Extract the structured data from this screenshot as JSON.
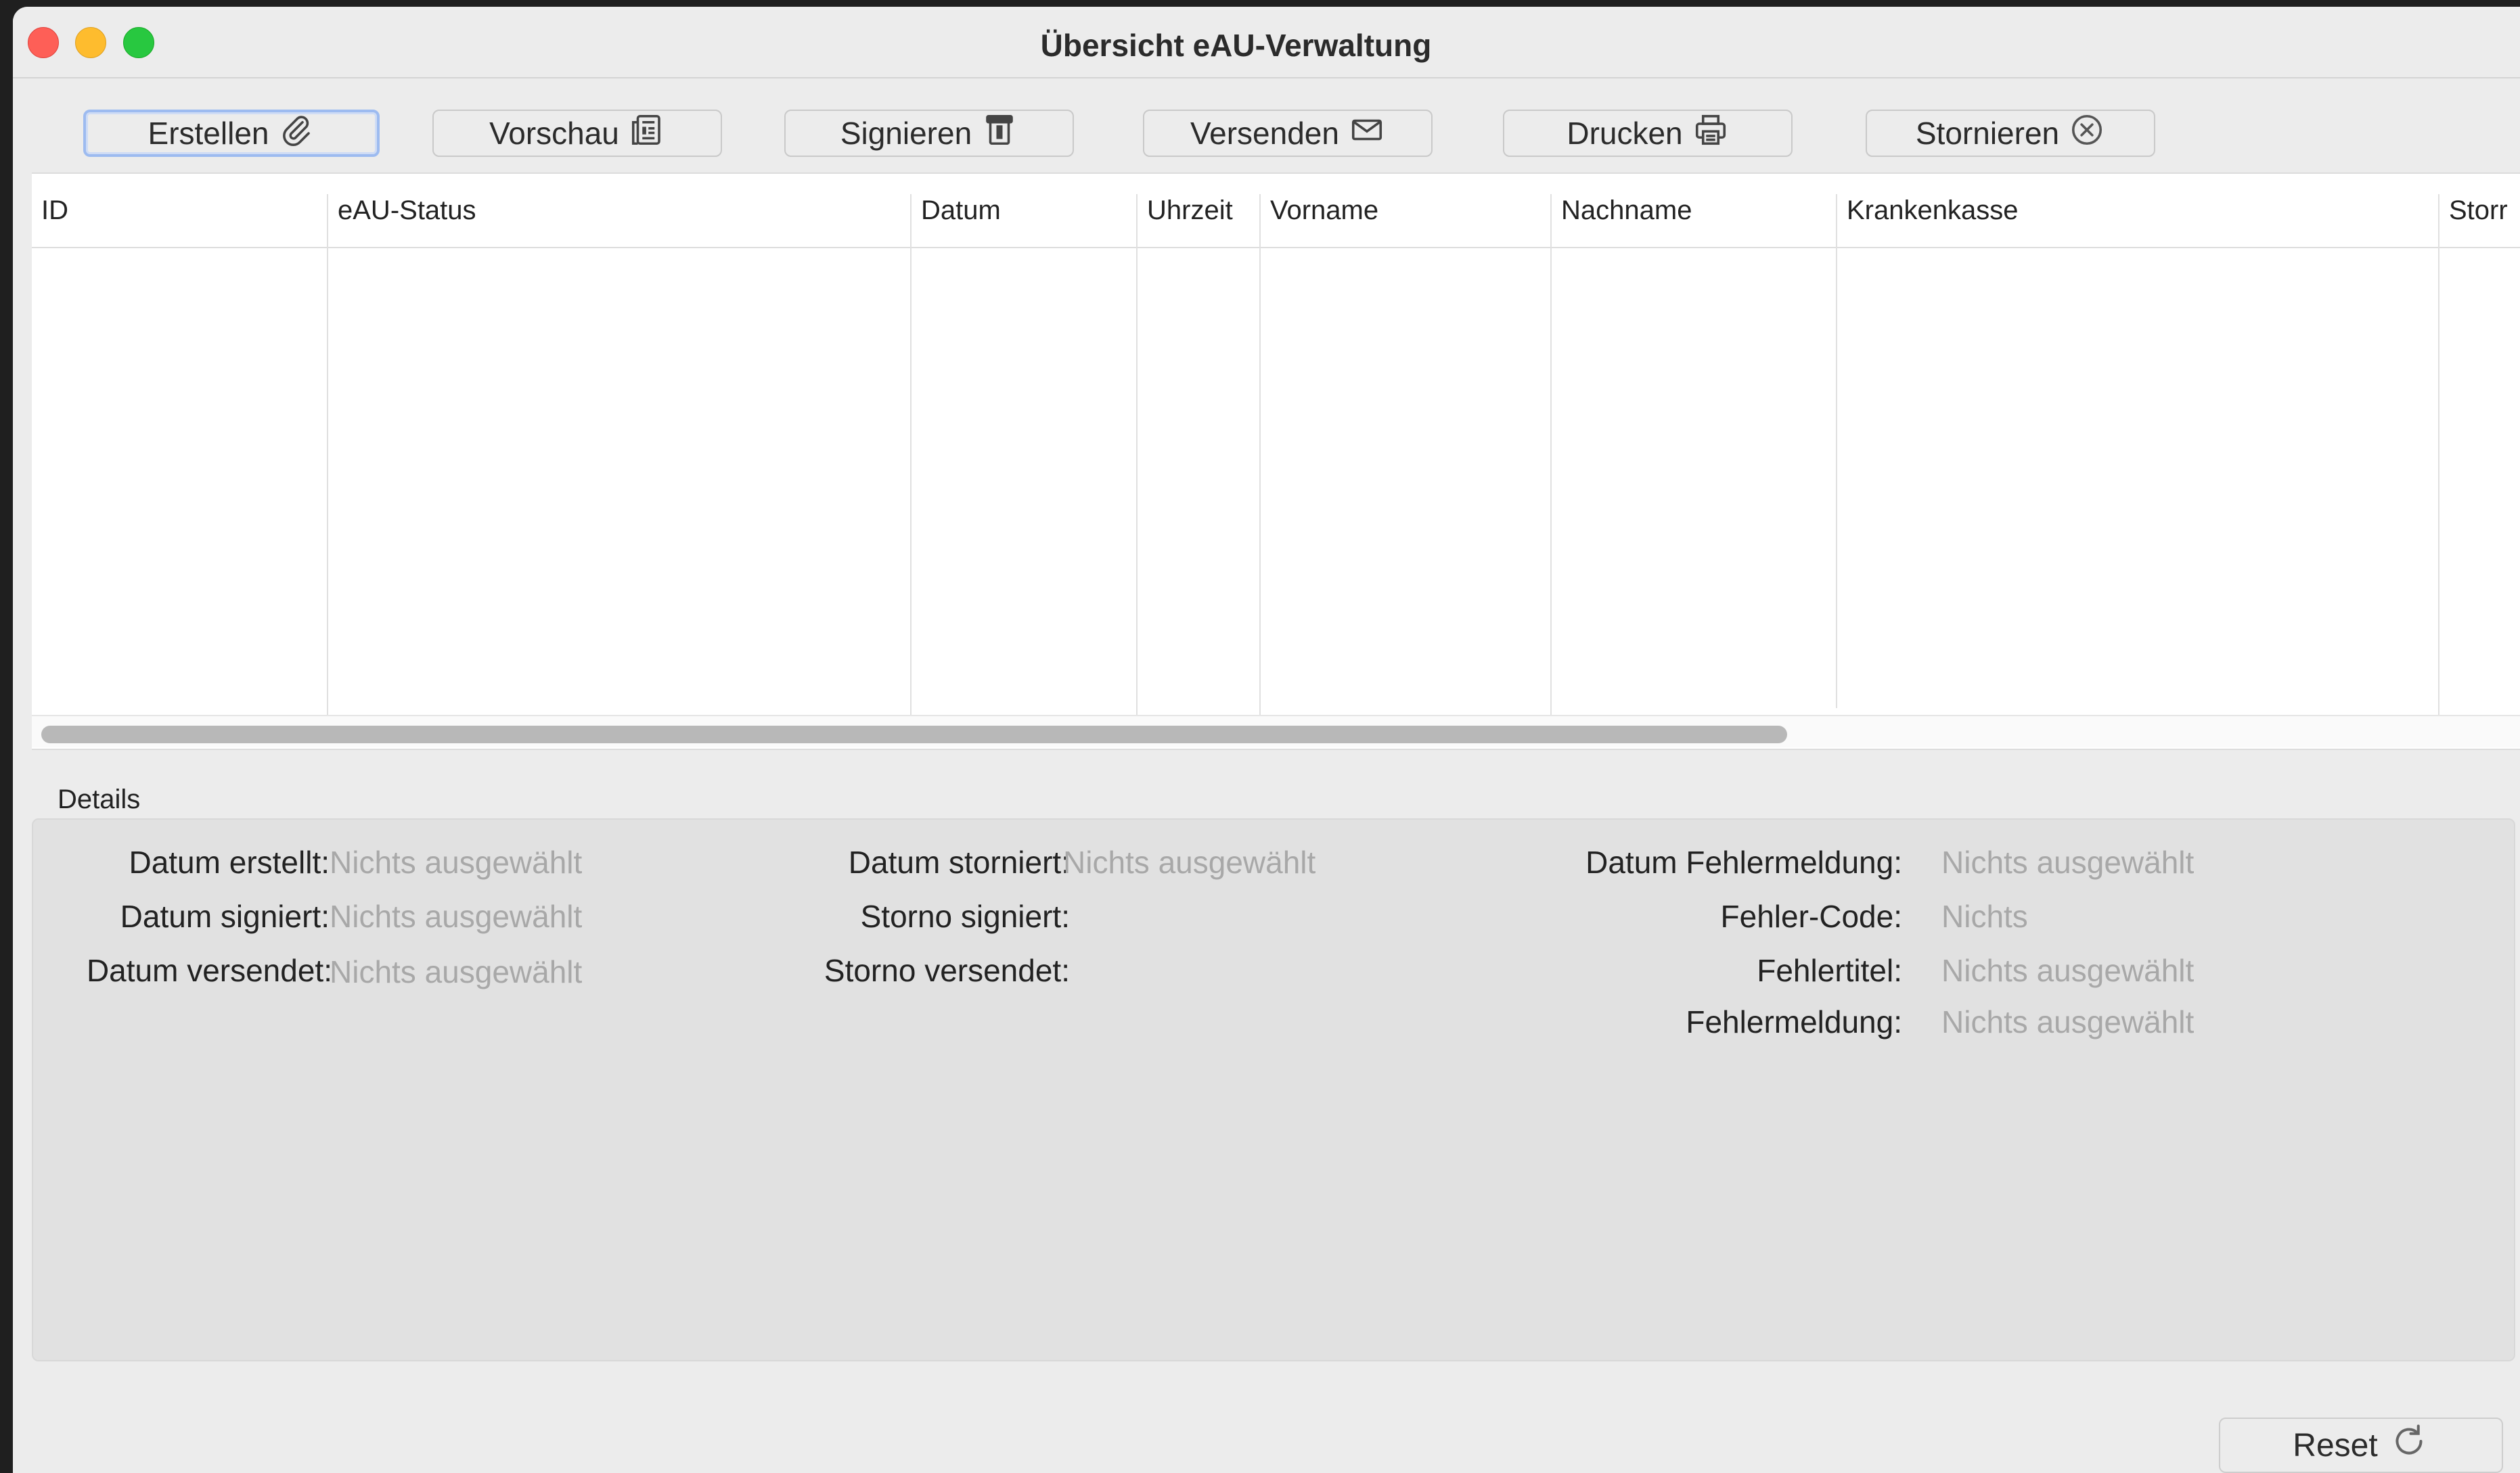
{
  "window": {
    "title": "Übersicht eAU-Verwaltung"
  },
  "toolbar": {
    "erstellen": {
      "label": "Erstellen",
      "icon": "paperclip-icon"
    },
    "vorschau": {
      "label": "Vorschau",
      "icon": "document-preview-icon"
    },
    "signieren": {
      "label": "Signieren",
      "icon": "card-reader-icon"
    },
    "versenden": {
      "label": "Versenden",
      "icon": "envelope-icon"
    },
    "drucken": {
      "label": "Drucken",
      "icon": "printer-icon"
    },
    "stornieren": {
      "label": "Stornieren",
      "icon": "cancel-circle-icon"
    }
  },
  "table": {
    "columns": [
      "ID",
      "eAU-Status",
      "Datum",
      "Uhrzeit",
      "Vorname",
      "Nachname",
      "Krankenkasse",
      "Storr"
    ],
    "rows": []
  },
  "details": {
    "section_title": "Details",
    "datum_erstellt": {
      "label": "Datum erstellt:",
      "value": "Nichts ausgewählt"
    },
    "datum_signiert": {
      "label": "Datum signiert:",
      "value": "Nichts ausgewählt"
    },
    "datum_versendet": {
      "label": "Datum versendet:",
      "value": "Nichts ausgewählt"
    },
    "datum_storniert": {
      "label": "Datum storniert:",
      "value": "Nichts ausgewählt"
    },
    "storno_signiert": {
      "label": "Storno signiert:",
      "value": ""
    },
    "storno_versendet": {
      "label": "Storno versendet:",
      "value": ""
    },
    "datum_fehlermeldung": {
      "label": "Datum Fehlermeldung:",
      "value": "Nichts ausgewählt"
    },
    "fehler_code": {
      "label": "Fehler-Code:",
      "value": "Nichts"
    },
    "fehlertitel": {
      "label": "Fehlertitel:",
      "value": "Nichts ausgewählt"
    },
    "fehlermeldung": {
      "label": "Fehlermeldung:",
      "value": "Nichts ausgewählt"
    }
  },
  "footer": {
    "reset": {
      "label": "Reset",
      "icon": "refresh-icon"
    }
  },
  "colors": {
    "close": "#fe5f57",
    "minimize": "#febc2e",
    "zoom": "#28c840",
    "focus_ring": "#9dbbf0",
    "placeholder_text": "#a8a8a8"
  }
}
